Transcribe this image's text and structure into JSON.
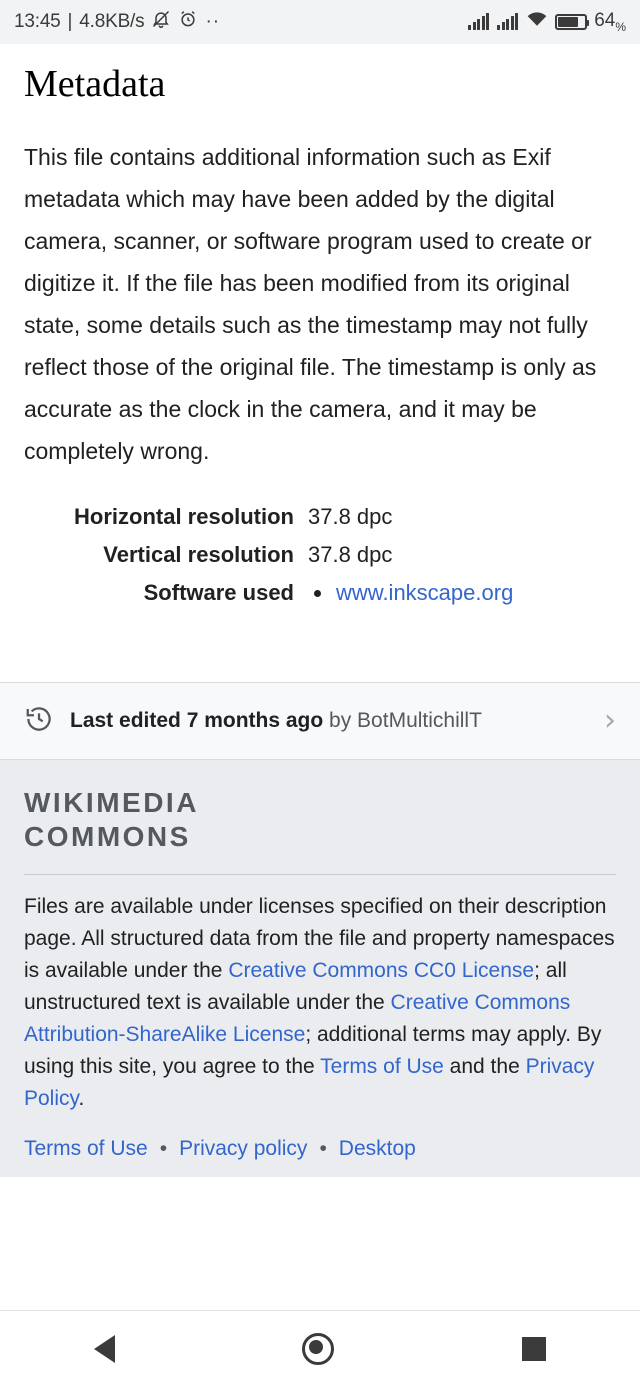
{
  "status_bar": {
    "time": "13:45",
    "separator": "|",
    "network_speed": "4.8KB/s",
    "mute_icon": "bell-muted-icon",
    "alarm_icon": "alarm-clock-icon",
    "dots": "··",
    "signal_icon_1": "signal-bars-icon",
    "signal_icon_2": "signal-bars-icon",
    "wifi_icon": "wifi-icon",
    "battery_icon": "battery-icon",
    "battery_level": "64",
    "battery_unit": "%"
  },
  "page": {
    "title": "Metadata",
    "paragraph": "This file contains additional information such as Exif metadata which may have been added by the digital camera, scanner, or software program used to create or digitize it. If the file has been modified from its original state, some details such as the timestamp may not fully reflect those of the original file. The timestamp is only as accurate as the clock in the camera, and it may be completely wrong."
  },
  "metadata_rows": [
    {
      "key": "Horizontal resolution",
      "value": "37.8 dpc",
      "is_list": false,
      "is_link": false
    },
    {
      "key": "Vertical resolution",
      "value": "37.8 dpc",
      "is_list": false,
      "is_link": false
    },
    {
      "key": "Software used",
      "value": "www.inkscape.org",
      "is_list": true,
      "is_link": true
    }
  ],
  "last_edited": {
    "icon": "history-clock-icon",
    "main": "Last edited 7 months ago",
    "by": " by BotMultichillT",
    "chevron": "›"
  },
  "footer": {
    "logo_line1": "WIKIMEDIA",
    "logo_line2": "COMMONS",
    "license_part1": "Files are available under licenses specified on their description page. All structured data from the file and property namespaces is available under the ",
    "license_link1": "Creative Commons CC0 License",
    "license_part2": "; all unstructured text is available under the ",
    "license_link2": "Creative Commons Attribution-ShareAlike License",
    "license_part3": "; additional terms may apply. By using this site, you agree to the ",
    "license_link3": "Terms of Use",
    "license_part4": " and the ",
    "license_link4": "Privacy Policy",
    "license_part5": ".",
    "links": [
      "Terms of Use",
      "Privacy policy",
      "Desktop"
    ],
    "separator": "•"
  },
  "navbar": {
    "back": "back-triangle-icon",
    "home": "home-circle-icon",
    "recent": "recents-square-icon"
  },
  "colors": {
    "link": "#3366cc",
    "status_bg": "#f2f3f4",
    "footer_bg": "#eaecf0",
    "last_edited_bg": "#f8f9fa"
  }
}
